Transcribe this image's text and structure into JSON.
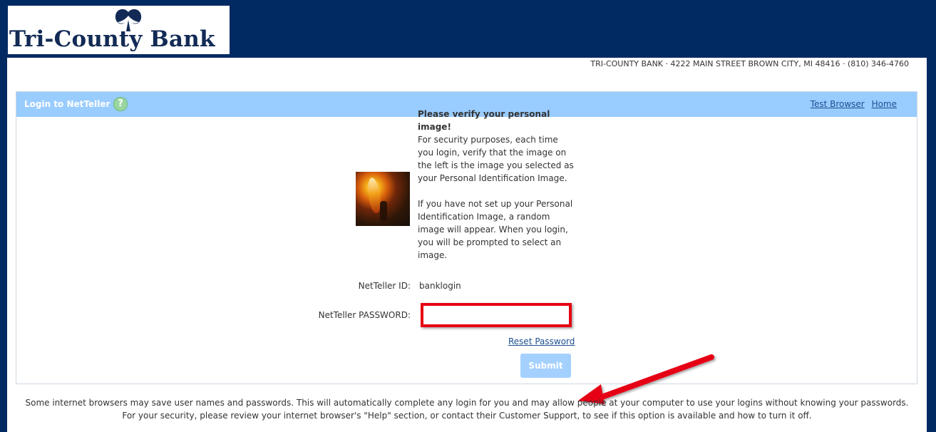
{
  "brand": {
    "name": "Tri-County Bank",
    "address": "TRI-COUNTY BANK · 4222 MAIN STREET BROWN CITY, MI 48416 · (810) 346-4760",
    "logo_icon": "bank-logo-icon",
    "colors": {
      "background": "#012a63",
      "header": "#99ccff",
      "link": "#1d4f91",
      "highlight": "#e60012",
      "submit": "#a4d0ff"
    }
  },
  "login": {
    "title": "Login to NetTeller",
    "help_icon": "help-icon",
    "help_label": "?",
    "links": {
      "test_browser": "Test Browser",
      "home": "Home"
    },
    "verification": {
      "title": "Please verify your personal image!",
      "paragraph_1": "For security purposes, each time you login, verify that the image on the left is the image you selected as your Personal Identification Image.",
      "paragraph_2": "If you have not set up your Personal Identification Image, a random image will appear. When you login, you will be prompted to select an image."
    },
    "fields": {
      "netteller_id_label": "NetTeller ID:",
      "netteller_id_value": "banklogin",
      "password_label": "NetTeller PASSWORD:",
      "password_value": "",
      "password_placeholder": ""
    },
    "reset_password": "Reset Password",
    "submit": "Submit"
  },
  "notice": "Some internet browsers may save user names and passwords. This will automatically complete any login for you and may allow people at your computer to use your logins without knowing your passwords. For your security, please review your internet browser's \"Help\" section, or contact their Customer Support, to see if this option is available and how to turn it off."
}
